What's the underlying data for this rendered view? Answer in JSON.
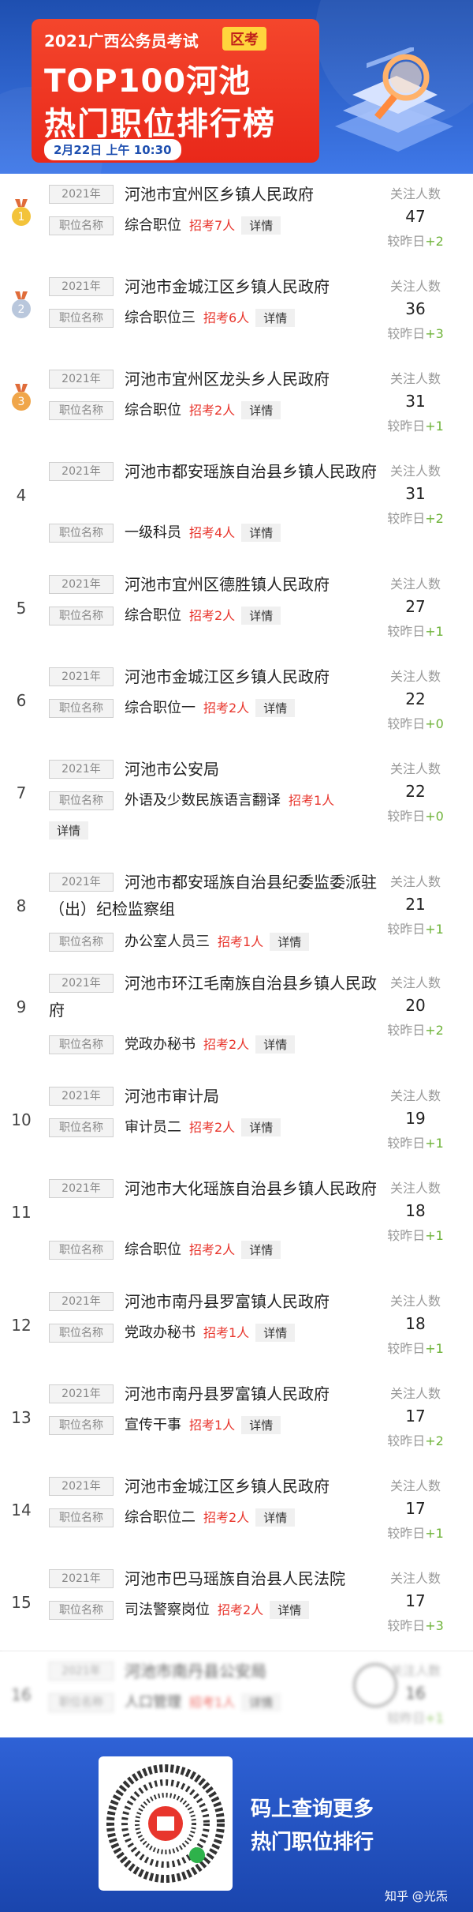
{
  "header": {
    "line1": "2021广西公务员考试",
    "tag": "区考",
    "line2": "TOP100河池",
    "line3": "热门职位排行榜",
    "date": "2月22日 上午 10:30"
  },
  "labels": {
    "year": "2021年",
    "position": "职位名称",
    "followers": "关注人数",
    "vs_yesterday": "较昨日",
    "detail": "详情"
  },
  "rows": [
    {
      "rank": "1",
      "org": "河池市宜州区乡镇人民政府",
      "position": "综合职位",
      "recruit": "招考7人",
      "count": "47",
      "delta": "+2"
    },
    {
      "rank": "2",
      "org": "河池市金城江区乡镇人民政府",
      "position": "综合职位三",
      "recruit": "招考6人",
      "count": "36",
      "delta": "+3"
    },
    {
      "rank": "3",
      "org": "河池市宜州区龙头乡人民政府",
      "position": "综合职位",
      "recruit": "招考2人",
      "count": "31",
      "delta": "+1"
    },
    {
      "rank": "4",
      "org": "河池市都安瑶族自治县乡镇人民政府",
      "position": "一级科员",
      "recruit": "招考4人",
      "count": "31",
      "delta": "+2"
    },
    {
      "rank": "5",
      "org": "河池市宜州区德胜镇人民政府",
      "position": "综合职位",
      "recruit": "招考2人",
      "count": "27",
      "delta": "+1"
    },
    {
      "rank": "6",
      "org": "河池市金城江区乡镇人民政府",
      "position": "综合职位一",
      "recruit": "招考2人",
      "count": "22",
      "delta": "+0"
    },
    {
      "rank": "7",
      "org": "河池市公安局",
      "position": "外语及少数民族语言翻译",
      "recruit": "招考1人",
      "count": "22",
      "delta": "+0"
    },
    {
      "rank": "8",
      "org": "河池市都安瑶族自治县纪委监委派驻（出）纪检监察组",
      "position": "办公室人员三",
      "recruit": "招考1人",
      "count": "21",
      "delta": "+1"
    },
    {
      "rank": "9",
      "org": "河池市环江毛南族自治县乡镇人民政府",
      "position": "党政办秘书",
      "recruit": "招考2人",
      "count": "20",
      "delta": "+2"
    },
    {
      "rank": "10",
      "org": "河池市审计局",
      "position": "审计员二",
      "recruit": "招考2人",
      "count": "19",
      "delta": "+1"
    },
    {
      "rank": "11",
      "org": "河池市大化瑶族自治县乡镇人民政府",
      "position": "综合职位",
      "recruit": "招考2人",
      "count": "18",
      "delta": "+1"
    },
    {
      "rank": "12",
      "org": "河池市南丹县罗富镇人民政府",
      "position": "党政办秘书",
      "recruit": "招考1人",
      "count": "18",
      "delta": "+1"
    },
    {
      "rank": "13",
      "org": "河池市南丹县罗富镇人民政府",
      "position": "宣传干事",
      "recruit": "招考1人",
      "count": "17",
      "delta": "+2"
    },
    {
      "rank": "14",
      "org": "河池市金城江区乡镇人民政府",
      "position": "综合职位二",
      "recruit": "招考2人",
      "count": "17",
      "delta": "+1"
    },
    {
      "rank": "15",
      "org": "河池市巴马瑶族自治县人民法院",
      "position": "司法警察岗位",
      "recruit": "招考2人",
      "count": "17",
      "delta": "+3"
    },
    {
      "rank": "16",
      "org": "河池市南丹县公安局",
      "position": "人口管理",
      "recruit": "招考1人",
      "count": "16",
      "delta": "+1"
    }
  ],
  "footer": {
    "line1": "码上查询更多",
    "line2": "热门职位排行",
    "watermark": "知乎 @光炁"
  },
  "colors": {
    "header_blue": "#2a5fd0",
    "title_red": "#ef3a24",
    "recruit_red": "#e8352c",
    "delta_green": "#6fb33a"
  }
}
